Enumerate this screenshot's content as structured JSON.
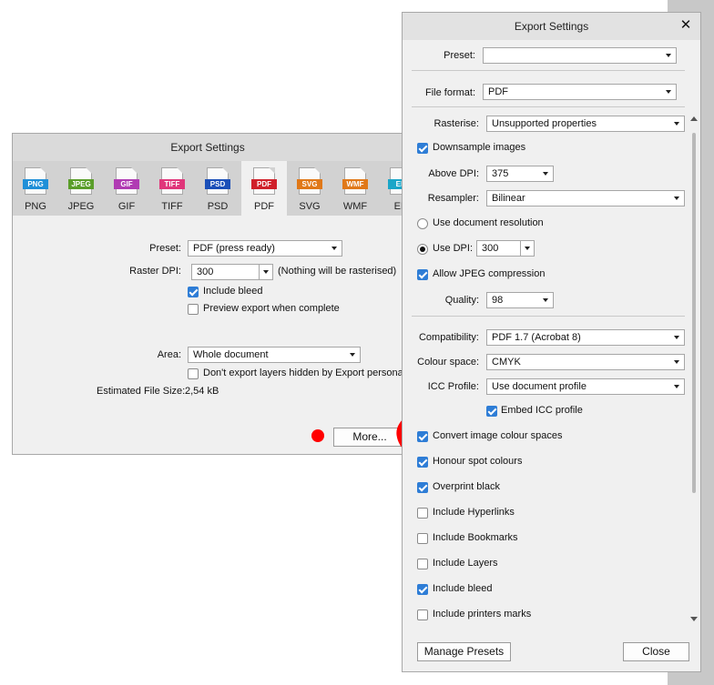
{
  "back_dialog": {
    "title": "Export Settings",
    "formats": [
      {
        "badge": "PNG",
        "label": "PNG",
        "color": "#1f8fd8"
      },
      {
        "badge": "JPEG",
        "label": "JPEG",
        "color": "#5a9e2a"
      },
      {
        "badge": "GIF",
        "label": "GIF",
        "color": "#b03bb3"
      },
      {
        "badge": "TIFF",
        "label": "TIFF",
        "color": "#e0367a"
      },
      {
        "badge": "PSD",
        "label": "PSD",
        "color": "#1b4fb8"
      },
      {
        "badge": "PDF",
        "label": "PDF",
        "color": "#d0202a"
      },
      {
        "badge": "SVG",
        "label": "SVG",
        "color": "#e07818"
      },
      {
        "badge": "WMF",
        "label": "WMF",
        "color": "#e07818"
      },
      {
        "badge": "EP",
        "label": "EP",
        "color": "#1aa6c8"
      }
    ],
    "selected_format": "PDF",
    "preset_label": "Preset:",
    "preset_value": "PDF (press ready)",
    "raster_dpi_label": "Raster DPI:",
    "raster_dpi_value": "300",
    "raster_note": "(Nothing will be rasterised)",
    "include_bleed": "Include bleed",
    "include_bleed_checked": true,
    "preview_export": "Preview export when complete",
    "preview_export_checked": false,
    "area_label": "Area:",
    "area_value": "Whole document",
    "dont_export_layers": "Don't export layers hidden by Export persona",
    "dont_export_layers_checked": false,
    "estimated_size_label": "Estimated File Size:",
    "estimated_size_value": "2,54 kB",
    "more_button": "More..."
  },
  "front_dialog": {
    "title": "Export Settings",
    "preset_label": "Preset:",
    "preset_value": "",
    "file_format_label": "File format:",
    "file_format_value": "PDF",
    "rasterise_label": "Rasterise:",
    "rasterise_value": "Unsupported properties",
    "downsample": "Downsample images",
    "downsample_checked": true,
    "above_dpi_label": "Above DPI:",
    "above_dpi_value": "375",
    "resampler_label": "Resampler:",
    "resampler_value": "Bilinear",
    "use_doc_resolution": "Use document resolution",
    "use_doc_resolution_selected": false,
    "use_dpi": "Use DPI:",
    "use_dpi_selected": true,
    "use_dpi_value": "300",
    "allow_jpeg": "Allow JPEG compression",
    "allow_jpeg_checked": true,
    "quality_label": "Quality:",
    "quality_value": "98",
    "compatibility_label": "Compatibility:",
    "compatibility_value": "PDF 1.7 (Acrobat 8)",
    "colour_space_label": "Colour space:",
    "colour_space_value": "CMYK",
    "icc_profile_label": "ICC Profile:",
    "icc_profile_value": "Use document profile",
    "embed_icc": "Embed ICC profile",
    "embed_icc_checked": true,
    "options": [
      {
        "label": "Convert image colour spaces",
        "checked": true
      },
      {
        "label": "Honour spot colours",
        "checked": true
      },
      {
        "label": "Overprint black",
        "checked": true
      },
      {
        "label": "Include Hyperlinks",
        "checked": false
      },
      {
        "label": "Include Bookmarks",
        "checked": false
      },
      {
        "label": "Include Layers",
        "checked": false
      },
      {
        "label": "Include bleed",
        "checked": true
      },
      {
        "label": "Include printers marks",
        "checked": false
      }
    ],
    "manage_presets": "Manage Presets",
    "close": "Close"
  }
}
